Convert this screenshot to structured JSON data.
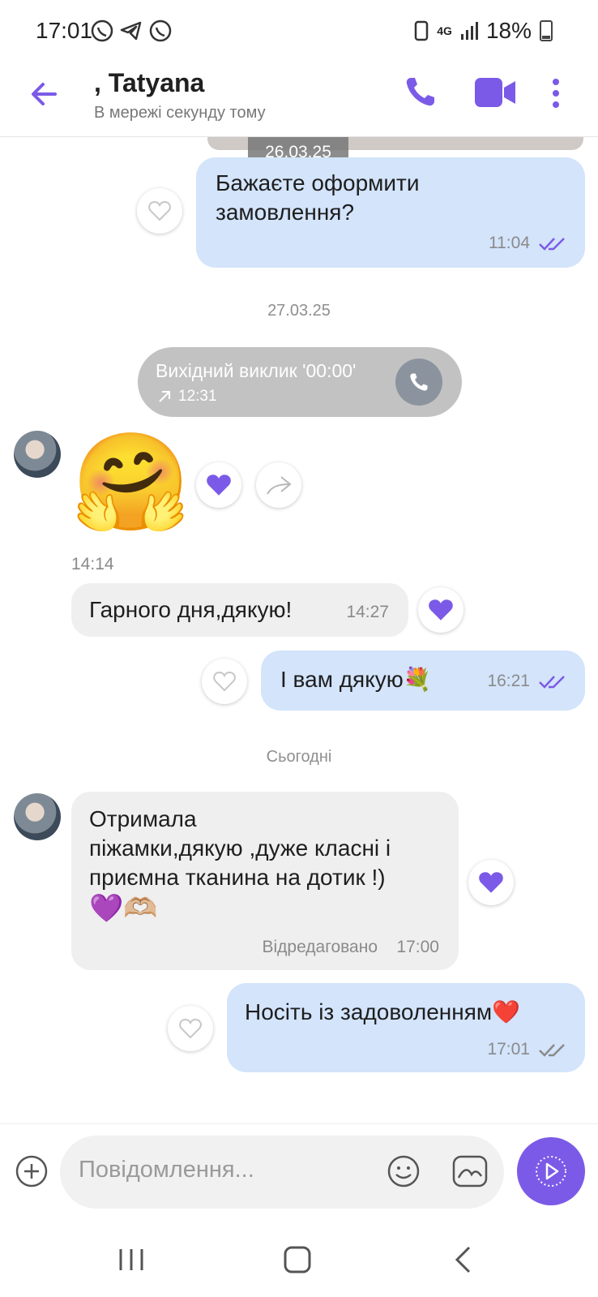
{
  "status_bar": {
    "time": "17:01",
    "network": "4G",
    "battery": "18%"
  },
  "header": {
    "contact_name": ", Tatyana",
    "contact_status": "В мережі секунду тому"
  },
  "messages": {
    "image_date_overlay": "26.03.25",
    "m1": {
      "text_line1": "Бажаєте оформити",
      "text_line2": "замовлення?",
      "time": "11:04"
    },
    "date2": "27.03.25",
    "call": {
      "title": "Вихідний виклик '00:00'",
      "time": "12:31"
    },
    "sticker_time": "14:14",
    "m2": {
      "text": "Гарного дня,дякую!",
      "time": "14:27"
    },
    "m3": {
      "text": "І вам дякую💐",
      "time": "16:21"
    },
    "date3": "Сьогодні",
    "m4": {
      "line1": "Отримала",
      "line2": "піжамки,дякую ,дуже класні і",
      "line3": "приємна тканина на дотик !)",
      "line4": "💜🫶🏼",
      "edited": "Відредаговано",
      "time": "17:00"
    },
    "m5": {
      "text": "Носіть із задоволенням❤️",
      "time": "17:01"
    }
  },
  "composer": {
    "placeholder": "Повідомлення..."
  },
  "colors": {
    "accent": "#7b5ae7",
    "outgoing_bubble": "#d3e4fb",
    "incoming_bubble": "#efefef"
  }
}
